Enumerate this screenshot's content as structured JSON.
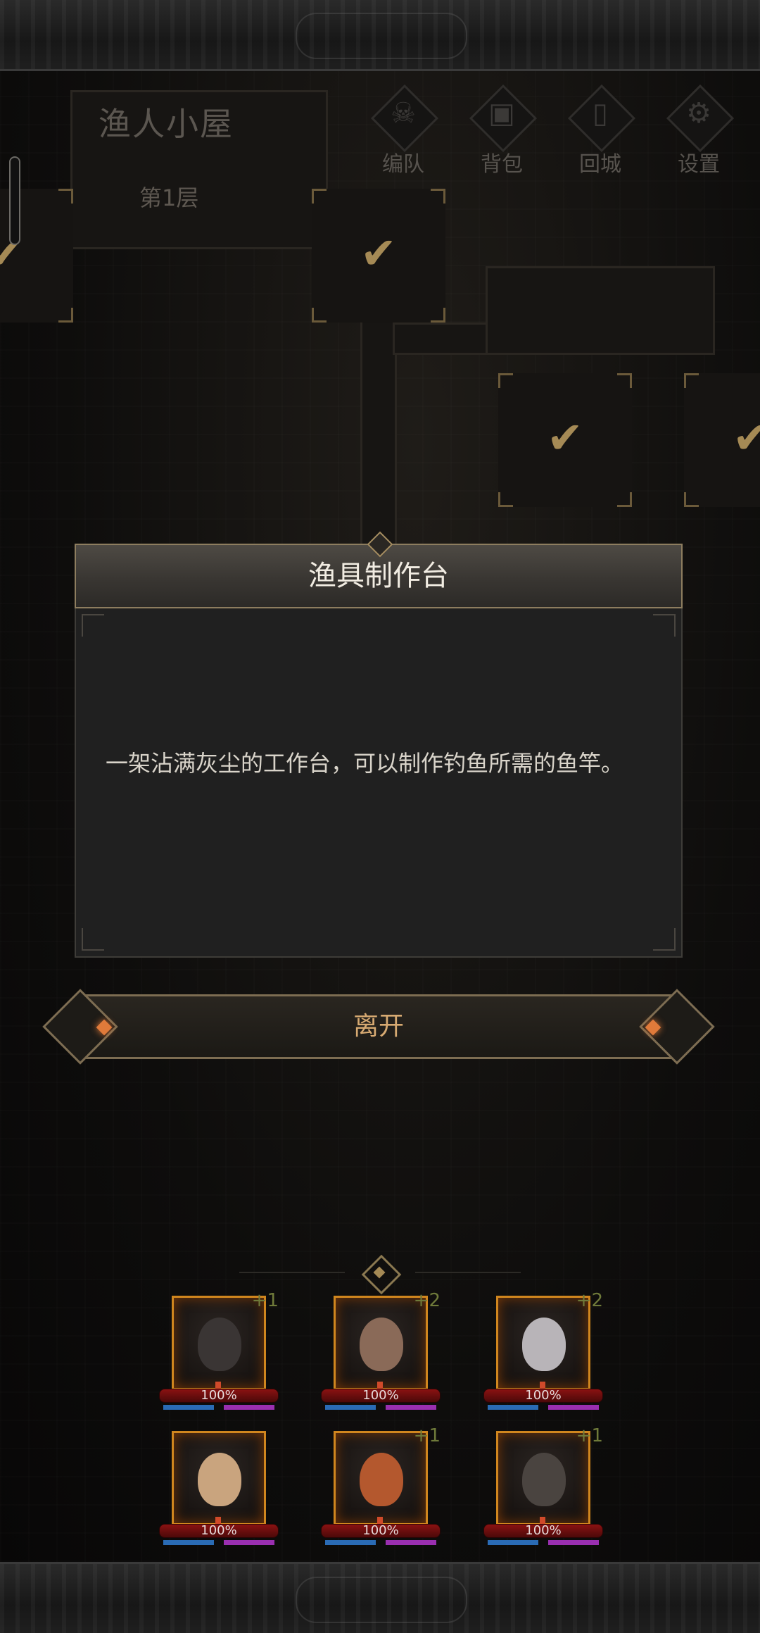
{
  "location": {
    "title": "渔人小屋",
    "floor": "第1层"
  },
  "menu": [
    {
      "label": "编队",
      "icon": "skull-helmet-icon"
    },
    {
      "label": "背包",
      "icon": "backpack-icon"
    },
    {
      "label": "回城",
      "icon": "door-icon"
    },
    {
      "label": "设置",
      "icon": "gear-icon"
    }
  ],
  "map": {
    "rooms_completed_marker": "✔"
  },
  "dialog": {
    "title": "渔具制作台",
    "description": "一架沾满灰尘的工作台，可以制作钓鱼所需的鱼竿。"
  },
  "leave_button": {
    "label": "离开"
  },
  "party": [
    {
      "bonus": "+1",
      "hp_percent": "100%",
      "face_color": "#3a3534"
    },
    {
      "bonus": "+2",
      "hp_percent": "100%",
      "face_color": "#8a6a58"
    },
    {
      "bonus": "+2",
      "hp_percent": "100%",
      "face_color": "#b8b4b8"
    },
    {
      "bonus": "",
      "hp_percent": "100%",
      "face_color": "#c9a47e"
    },
    {
      "bonus": "+1",
      "hp_percent": "100%",
      "face_color": "#b4582e"
    },
    {
      "bonus": "+1",
      "hp_percent": "100%",
      "face_color": "#4a4440"
    }
  ],
  "colors": {
    "accent_gold": "#a58a55",
    "button_text": "#d7aa72",
    "hp_red": "#8a1212"
  }
}
